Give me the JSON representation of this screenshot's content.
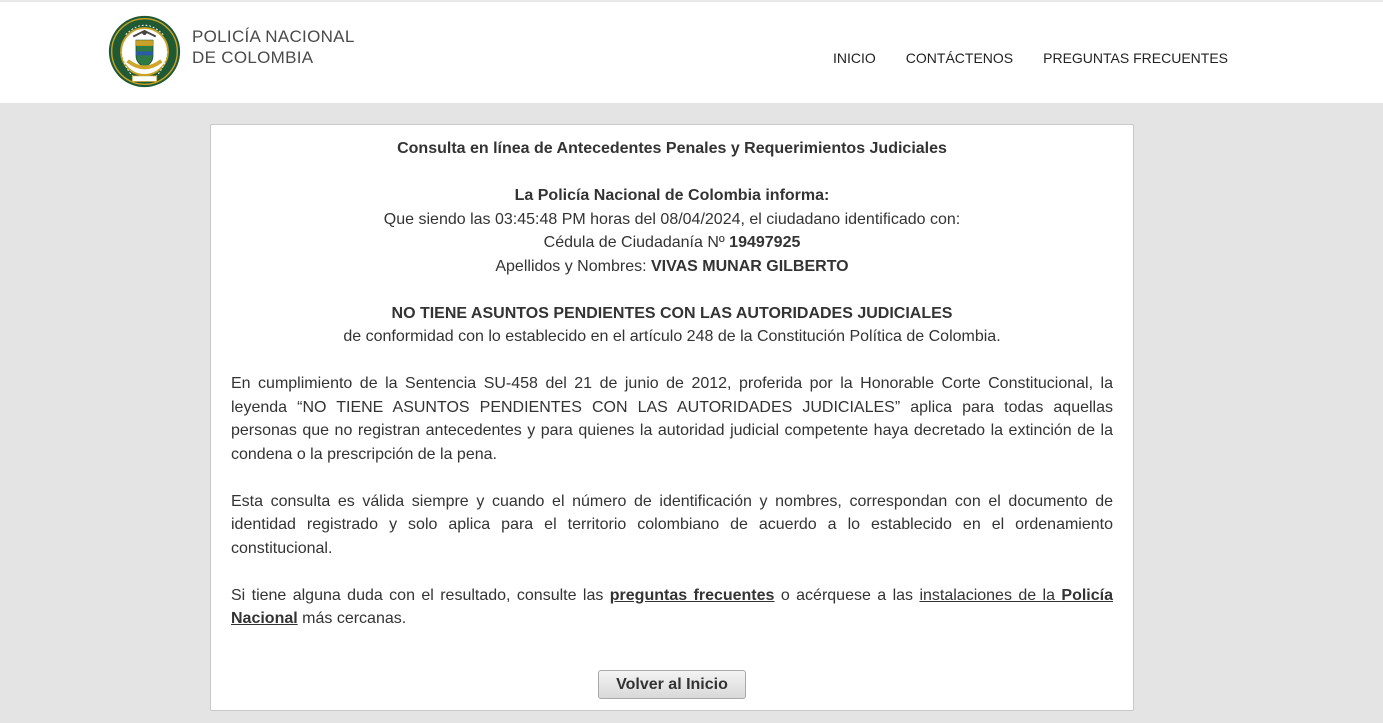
{
  "header": {
    "brand_line1": "POLICÍA NACIONAL",
    "brand_line2": "DE COLOMBIA",
    "nav": [
      "INICIO",
      "CONTÁCTENOS",
      "PREGUNTAS FRECUENTES"
    ]
  },
  "result": {
    "title": "Consulta en línea de Antecedentes Penales y Requerimientos Judiciales",
    "informa": "La Policía Nacional de Colombia informa:",
    "line_time": "Que siendo las 03:45:48 PM horas del 08/04/2024, el ciudadano identificado con:",
    "id_label": "Cédula de Ciudadanía Nº",
    "id_number": "19497925",
    "name_label": "Apellidos y Nombres:",
    "name_value": "VIVAS MUNAR GILBERTO",
    "status": "NO TIENE ASUNTOS PENDIENTES CON LAS AUTORIDADES JUDICIALES",
    "status_note": "de conformidad con lo establecido en el artículo 248 de la Constitución Política de Colombia.",
    "para1": "En cumplimiento de la Sentencia SU-458 del 21 de junio de 2012, proferida por la Honorable Corte Constitucional, la leyenda “NO TIENE ASUNTOS PENDIENTES CON LAS AUTORIDADES JUDICIALES” aplica para todas aquellas personas que no registran antecedentes y para quienes la autoridad judicial competente haya decretado la extinción de la condena o la prescripción de la pena.",
    "para2": "Esta consulta es válida siempre y cuando el número de identificación y nombres, correspondan con el documento de identidad registrado y solo aplica para el territorio colombiano de acuerdo a lo establecido en el ordenamiento constitucional.",
    "para3_a": "Si tiene alguna duda con el resultado, consulte las",
    "para3_link1": "preguntas frecuentes",
    "para3_b": "o acérquese a las",
    "para3_link2_a": "instalaciones de la",
    "para3_link2_b": "Policía Nacional",
    "para3_c": "más cercanas.",
    "button": "Volver al Inicio"
  },
  "icons": {
    "seal": "police-seal-icon"
  },
  "colors": {
    "background": "#e4e4e4",
    "seal_green": "#1f5a34",
    "seal_gold": "#c9a227"
  }
}
